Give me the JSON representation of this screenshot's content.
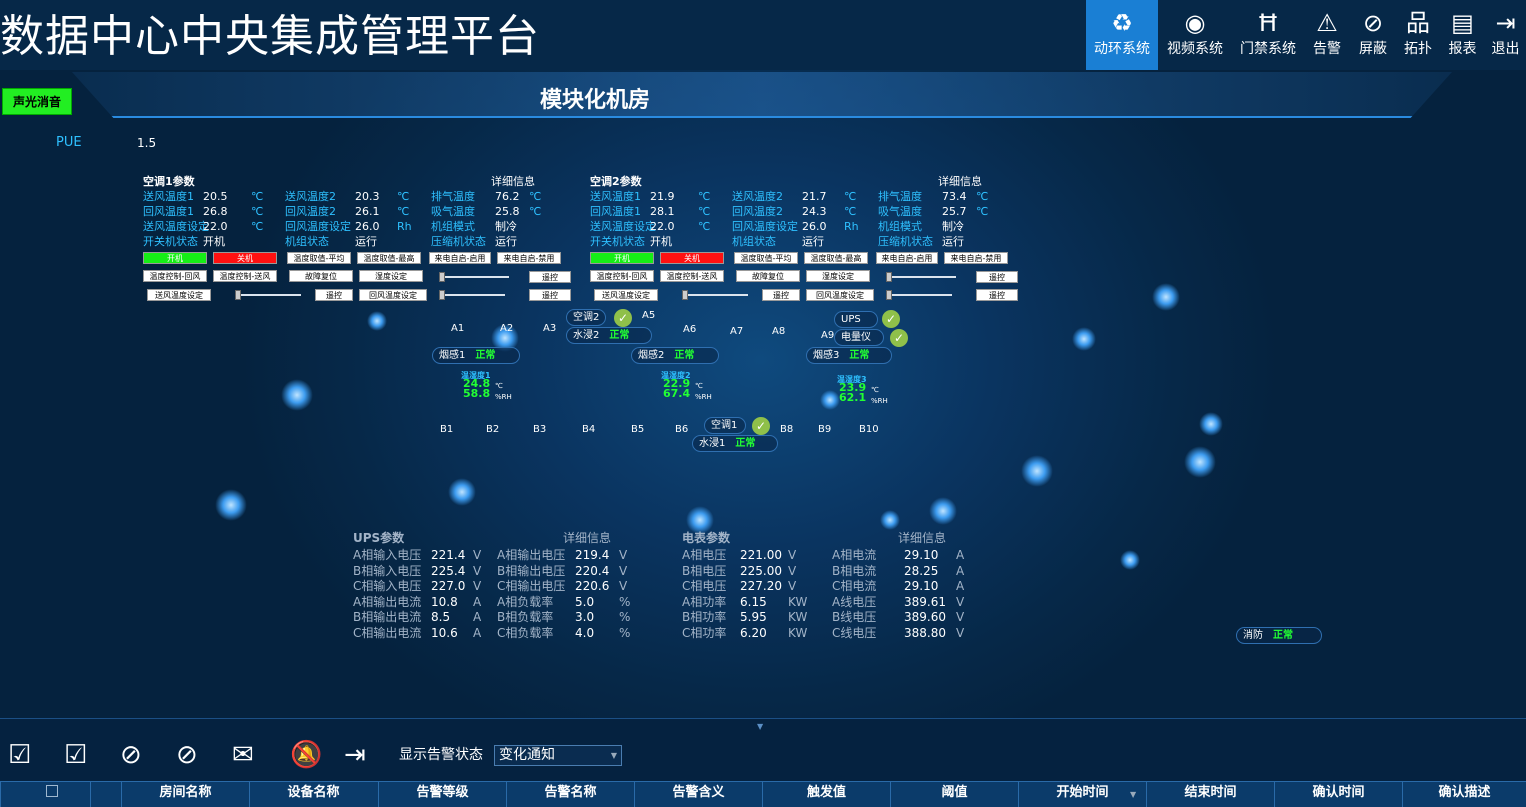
{
  "app_title": "数据中心中央集成管理平台",
  "nav": [
    {
      "label": "动环系统",
      "icon": "recycle-icon",
      "active": true
    },
    {
      "label": "视频系统",
      "icon": "camera-icon"
    },
    {
      "label": "门禁系统",
      "icon": "door-icon"
    },
    {
      "label": "告警",
      "icon": "alarm-icon"
    },
    {
      "label": "屏蔽",
      "icon": "block-icon"
    },
    {
      "label": "拓扑",
      "icon": "topology-icon"
    },
    {
      "label": "报表",
      "icon": "report-icon"
    },
    {
      "label": "退出",
      "icon": "logout-icon"
    }
  ],
  "banner_title": "模块化机房",
  "alarm_mute": "声光消音",
  "pue": {
    "label": "PUE",
    "value": "1.5"
  },
  "ac1": {
    "title": "空调1参数",
    "detail": "详细信息",
    "rows": [
      [
        "送风温度1",
        "20.5",
        "℃",
        "送风温度2",
        "20.3",
        "℃",
        "排气温度",
        "76.2",
        "℃"
      ],
      [
        "回风温度1",
        "26.8",
        "℃",
        "回风温度2",
        "26.1",
        "℃",
        "吸气温度",
        "25.8",
        "℃"
      ],
      [
        "送风温度设定",
        "22.0",
        "℃",
        "回风温度设定",
        "26.0",
        "Rh",
        "机组模式",
        "制冷",
        ""
      ],
      [
        "开关机状态",
        "开机",
        "",
        "机组状态",
        "运行",
        "",
        "压缩机状态",
        "运行",
        ""
      ]
    ],
    "buttons": [
      "开机",
      "关机",
      "温度取值-平均",
      "温度取值-最高",
      "来电自启-启用",
      "来电自启-禁用",
      "温度控制-回风",
      "温度控制-送风",
      "故障复位",
      "湿度设定",
      "遥控",
      "送风温度设定",
      "遥控",
      "回风温度设定",
      "遥控"
    ]
  },
  "ac2": {
    "title": "空调2参数",
    "detail": "详细信息",
    "rows": [
      [
        "送风温度1",
        "21.9",
        "℃",
        "送风温度2",
        "21.7",
        "℃",
        "排气温度",
        "73.4",
        "℃"
      ],
      [
        "回风温度1",
        "28.1",
        "℃",
        "回风温度2",
        "24.3",
        "℃",
        "吸气温度",
        "25.7",
        "℃"
      ],
      [
        "送风温度设定",
        "22.0",
        "℃",
        "回风温度设定",
        "26.0",
        "Rh",
        "机组模式",
        "制冷",
        ""
      ],
      [
        "开关机状态",
        "开机",
        "",
        "机组状态",
        "运行",
        "",
        "压缩机状态",
        "运行",
        ""
      ]
    ],
    "buttons": [
      "开机",
      "关机",
      "温度取值-平均",
      "温度取值-最高",
      "来电自启-启用",
      "来电自启-禁用",
      "温度控制-回风",
      "温度控制-送风",
      "故障复位",
      "湿度设定",
      "遥控",
      "送风温度设定",
      "遥控",
      "回风温度设定",
      "遥控"
    ]
  },
  "row_a": [
    "A1",
    "A2",
    "A3",
    "A5",
    "A6",
    "A7",
    "A8",
    "A9"
  ],
  "row_b": [
    "B1",
    "B2",
    "B3",
    "B4",
    "B5",
    "B6",
    "B8",
    "B9",
    "B10"
  ],
  "devices": {
    "ac2": "空调2",
    "water2": "水浸2",
    "ups": "UPS",
    "meter": "电量仪",
    "smoke1": "烟感1",
    "smoke2": "烟感2",
    "smoke3": "烟感3",
    "ac1": "空调1",
    "water1": "水浸1",
    "fire": "消防",
    "ok": "正常"
  },
  "th": [
    {
      "name": "温湿度1",
      "t": "24.8",
      "h": "58.8"
    },
    {
      "name": "温湿度2",
      "t": "22.9",
      "h": "67.4"
    },
    {
      "name": "温湿度3",
      "t": "23.9",
      "h": "62.1"
    }
  ],
  "th_units": {
    "t": "℃",
    "h": "%RH"
  },
  "ups": {
    "title": "UPS参数",
    "detail": "详细信息",
    "rows": [
      [
        "A相输入电压",
        "221.4",
        "V",
        "A相输出电压",
        "219.4",
        "V"
      ],
      [
        "B相输入电压",
        "225.4",
        "V",
        "B相输出电压",
        "220.4",
        "V"
      ],
      [
        "C相输入电压",
        "227.0",
        "V",
        "C相输出电压",
        "220.6",
        "V"
      ],
      [
        "A相输出电流",
        "10.8",
        "A",
        "A相负载率",
        "5.0",
        "%"
      ],
      [
        "B相输出电流",
        "8.5",
        "A",
        "B相负载率",
        "3.0",
        "%"
      ],
      [
        "C相输出电流",
        "10.6",
        "A",
        "C相负载率",
        "4.0",
        "%"
      ]
    ]
  },
  "meter": {
    "title": "电表参数",
    "detail": "详细信息",
    "rows": [
      [
        "A相电压",
        "221.00",
        "V",
        "A相电流",
        "29.10",
        "A"
      ],
      [
        "B相电压",
        "225.00",
        "V",
        "B相电流",
        "28.25",
        "A"
      ],
      [
        "C相电压",
        "227.20",
        "V",
        "C相电流",
        "29.10",
        "A"
      ],
      [
        "A相功率",
        "6.15",
        "KW",
        "A线电压",
        "389.61",
        "V"
      ],
      [
        "B相功率",
        "5.95",
        "KW",
        "B线电压",
        "389.60",
        "V"
      ],
      [
        "C相功率",
        "6.20",
        "KW",
        "C线电压",
        "388.80",
        "V"
      ]
    ]
  },
  "alarm_state": {
    "label": "显示告警状态",
    "value": "变化通知"
  },
  "columns": [
    "房间名称",
    "设备名称",
    "告警等级",
    "告警名称",
    "告警含义",
    "触发值",
    "阈值",
    "开始时间",
    "结束时间",
    "确认时间",
    "确认描述"
  ],
  "colors": {
    "accent": "#1a7fd4",
    "ok": "#22ff33",
    "label": "#2ec0ff",
    "bg": "#062848"
  }
}
